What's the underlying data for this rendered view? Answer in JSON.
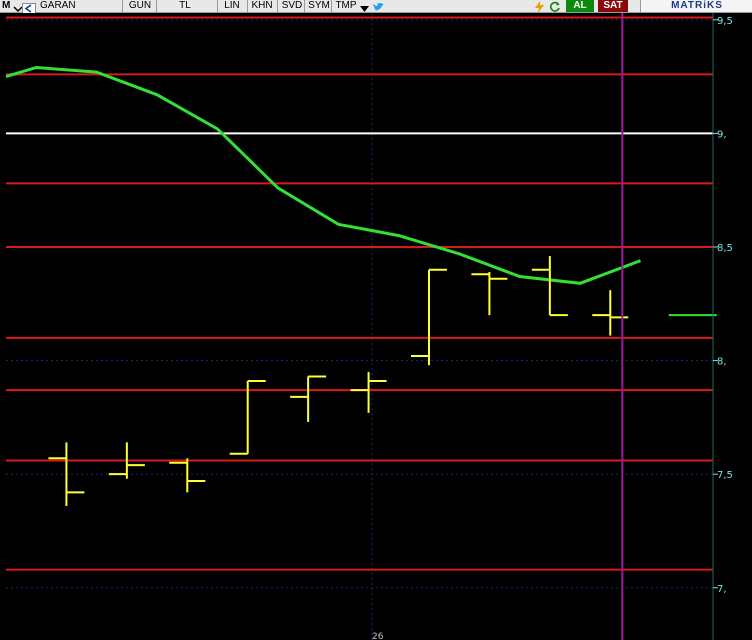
{
  "toolbar": {
    "m_label": "M",
    "symbol": "GARAN",
    "period": "GUN",
    "currency": "TL",
    "scale": "LIN",
    "buttons": [
      "KHN",
      "SVD",
      "SYM",
      "TMP"
    ],
    "buy": "AL",
    "sell": "SAT",
    "brand": "MATRiKS",
    "icons": [
      "chevron-down-icon",
      "twitter-bird-icon",
      "lightning-icon",
      "refresh-icon"
    ]
  },
  "colors": {
    "background": "#000000",
    "hline": "#d81a1a",
    "hline_white": "#ffffff",
    "bars": "#ffff33",
    "moving_average": "#33e033",
    "cursor": "#a01aa0",
    "ticks": "#7fe0e0"
  },
  "axis": {
    "y_ticks": [
      {
        "value": 9.5,
        "label": "9,5"
      },
      {
        "value": 9.0,
        "label": "9,"
      },
      {
        "value": 8.5,
        "label": "8,5"
      },
      {
        "value": 8.0,
        "label": "8,"
      },
      {
        "value": 7.5,
        "label": "7,5"
      },
      {
        "value": 7.0,
        "label": "7,"
      }
    ],
    "x_label": "26"
  },
  "chart_data": {
    "type": "line",
    "ylim": [
      6.77,
      9.53
    ],
    "y_axis_position": "right",
    "grid": true,
    "bars": [
      {
        "x": 1,
        "open": 7.57,
        "high": 7.64,
        "low": 7.36,
        "close": 7.42
      },
      {
        "x": 2,
        "open": 7.5,
        "high": 7.64,
        "low": 7.48,
        "close": 7.54
      },
      {
        "x": 3,
        "open": 7.55,
        "high": 7.57,
        "low": 7.42,
        "close": 7.47
      },
      {
        "x": 4,
        "open": 7.59,
        "high": 7.91,
        "low": 7.59,
        "close": 7.91
      },
      {
        "x": 5,
        "open": 7.84,
        "high": 7.93,
        "low": 7.73,
        "close": 7.93
      },
      {
        "x": 6,
        "open": 7.87,
        "high": 7.95,
        "low": 7.77,
        "close": 7.91
      },
      {
        "x": 7,
        "open": 8.02,
        "high": 8.4,
        "low": 7.98,
        "close": 8.4
      },
      {
        "x": 8,
        "open": 8.38,
        "high": 8.39,
        "low": 8.2,
        "close": 8.36
      },
      {
        "x": 9,
        "open": 8.4,
        "high": 8.46,
        "low": 8.2,
        "close": 8.2
      },
      {
        "x": 10,
        "open": 8.2,
        "high": 8.31,
        "low": 8.11,
        "close": 8.19
      },
      {
        "x": 11,
        "open": 8.2,
        "high": 8.2,
        "low": 8.2,
        "close": 8.2
      }
    ],
    "moving_average": [
      {
        "x": 0,
        "y": 9.25
      },
      {
        "x": 0.5,
        "y": 9.29
      },
      {
        "x": 1.5,
        "y": 9.27
      },
      {
        "x": 2.5,
        "y": 9.17
      },
      {
        "x": 3.5,
        "y": 9.02
      },
      {
        "x": 4.5,
        "y": 8.76
      },
      {
        "x": 5.5,
        "y": 8.6
      },
      {
        "x": 6.5,
        "y": 8.55
      },
      {
        "x": 7.5,
        "y": 8.47
      },
      {
        "x": 8.5,
        "y": 8.37
      },
      {
        "x": 9.5,
        "y": 8.34
      },
      {
        "x": 10.5,
        "y": 8.44
      }
    ],
    "horizontal_lines": [
      {
        "y": 9.51,
        "color": "red"
      },
      {
        "y": 9.26,
        "color": "red"
      },
      {
        "y": 9.0,
        "color": "white"
      },
      {
        "y": 8.78,
        "color": "red"
      },
      {
        "y": 8.5,
        "color": "red"
      },
      {
        "y": 8.1,
        "color": "red"
      },
      {
        "y": 7.87,
        "color": "red"
      },
      {
        "y": 7.56,
        "color": "red"
      },
      {
        "y": 7.08,
        "color": "red"
      }
    ],
    "cursor_x": 10.2
  }
}
